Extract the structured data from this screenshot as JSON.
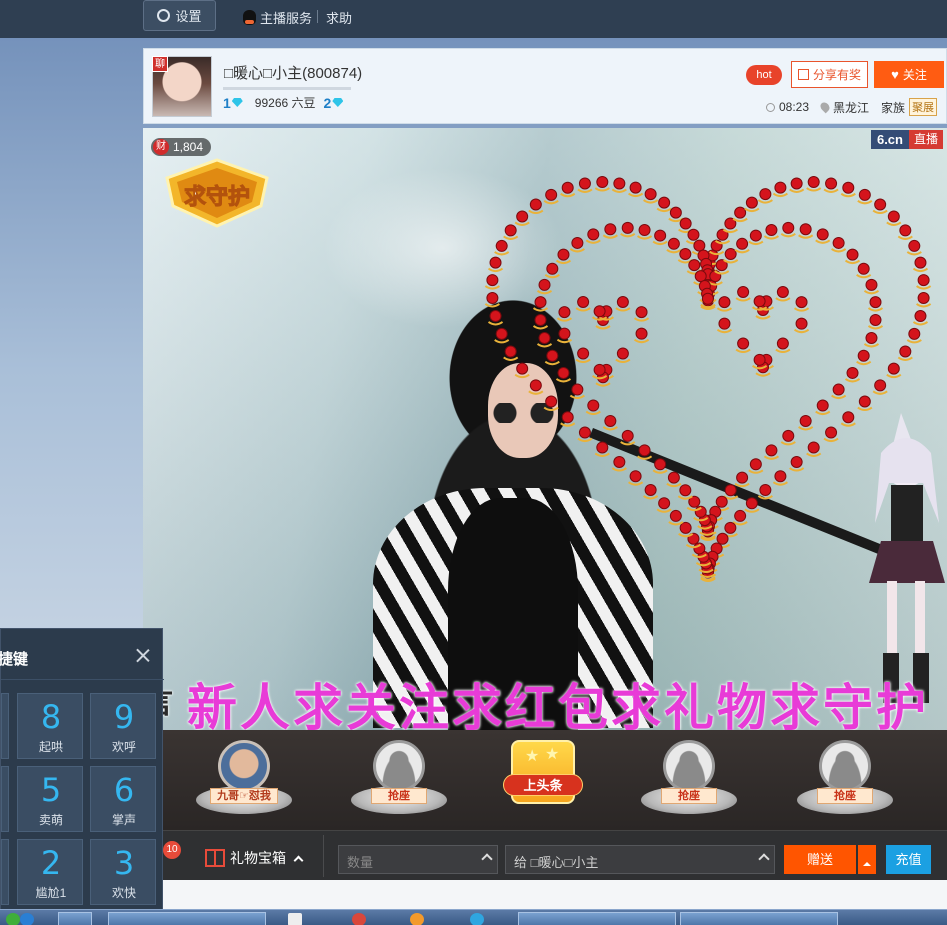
{
  "nav": {
    "settings_label": "设置",
    "anchor_service_label": "主播服务",
    "help_label": "求助"
  },
  "anchor": {
    "name": "□暖心□小主(800874)",
    "chat_badge": "聊",
    "level_left": "1",
    "beans": "99266 六豆",
    "level_right": "2",
    "hot_label": "hot",
    "share_label": "分享有奖",
    "follow_label": "关注",
    "time": "08:23",
    "location": "黑龙江",
    "family_label": "家族",
    "family_tag": "聚展"
  },
  "video": {
    "wealth_badge_icon": "财",
    "wealth_count": "1,804",
    "brand_logo": "6.cn",
    "brand_live": "直播",
    "guard_badge_text": "求守护",
    "marquee_text": "新人求关注求红包求礼物求守护",
    "marquee_prefix": "言"
  },
  "seats": [
    {
      "label": "九哥☞怼我",
      "state": "occupied"
    },
    {
      "label": "抢座",
      "state": "empty"
    },
    {
      "label": "上头条",
      "state": "headline"
    },
    {
      "label": "抢座",
      "state": "empty"
    },
    {
      "label": "抢座",
      "state": "empty"
    }
  ],
  "gift_bar": {
    "gift_box_label": "礼物宝箱",
    "gift_count": "10",
    "quantity_placeholder": "数量",
    "recipient_label": "给 □暖心□小主",
    "send_label": "赠送",
    "recharge_label": "充值"
  },
  "shortcut": {
    "title": "捷键",
    "keys": [
      {
        "num": "8",
        "label": "起哄"
      },
      {
        "num": "9",
        "label": "欢呼"
      },
      {
        "num": "5",
        "label": "卖萌"
      },
      {
        "num": "6",
        "label": "掌声"
      },
      {
        "num": "2",
        "label": "尴尬1"
      },
      {
        "num": "3",
        "label": "欢快"
      }
    ]
  },
  "colors": {
    "accent_orange": "#ff5c12",
    "recharge_blue": "#1ba0e2",
    "marquee_magenta": "#e83bd7",
    "hotkey_blue": "#35b7f0"
  }
}
